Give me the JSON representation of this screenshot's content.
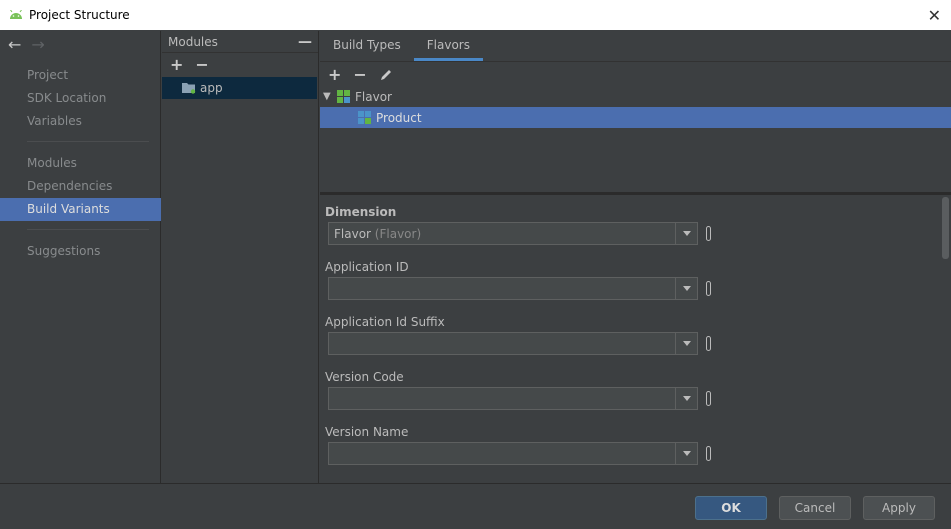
{
  "window": {
    "title": "Project Structure",
    "close_icon": "close-icon",
    "app_icon": "android-icon"
  },
  "nav": {
    "back_icon": "arrow-left-icon",
    "forward_icon": "arrow-right-icon"
  },
  "sidebar": {
    "groups": [
      [
        "Project",
        "SDK Location",
        "Variables"
      ],
      [
        "Modules",
        "Dependencies",
        "Build Variants"
      ],
      [
        "Suggestions"
      ]
    ],
    "selected": "Build Variants"
  },
  "modules": {
    "header": "Modules",
    "items": [
      {
        "label": "app",
        "icon": "module-folder-icon",
        "selected": true
      }
    ]
  },
  "tabs": [
    {
      "label": "Build Types",
      "active": false
    },
    {
      "label": "Flavors",
      "active": true
    }
  ],
  "tree": {
    "root": {
      "label": "Flavor",
      "expanded": true
    },
    "children": [
      {
        "label": "Product",
        "selected": true
      }
    ]
  },
  "form": {
    "fields": [
      {
        "label": "Dimension",
        "bold": true,
        "value": "Flavor",
        "value_hint": "(Flavor)"
      },
      {
        "label": "Application ID",
        "value": ""
      },
      {
        "label": "Application Id Suffix",
        "value": ""
      },
      {
        "label": "Version Code",
        "value": ""
      },
      {
        "label": "Version Name",
        "value": ""
      }
    ]
  },
  "buttons": {
    "ok": "OK",
    "cancel": "Cancel",
    "apply": "Apply"
  },
  "colors": {
    "selection": "#4b6eaf",
    "primary_button": "#365880",
    "tab_underline": "#4a88c7"
  }
}
